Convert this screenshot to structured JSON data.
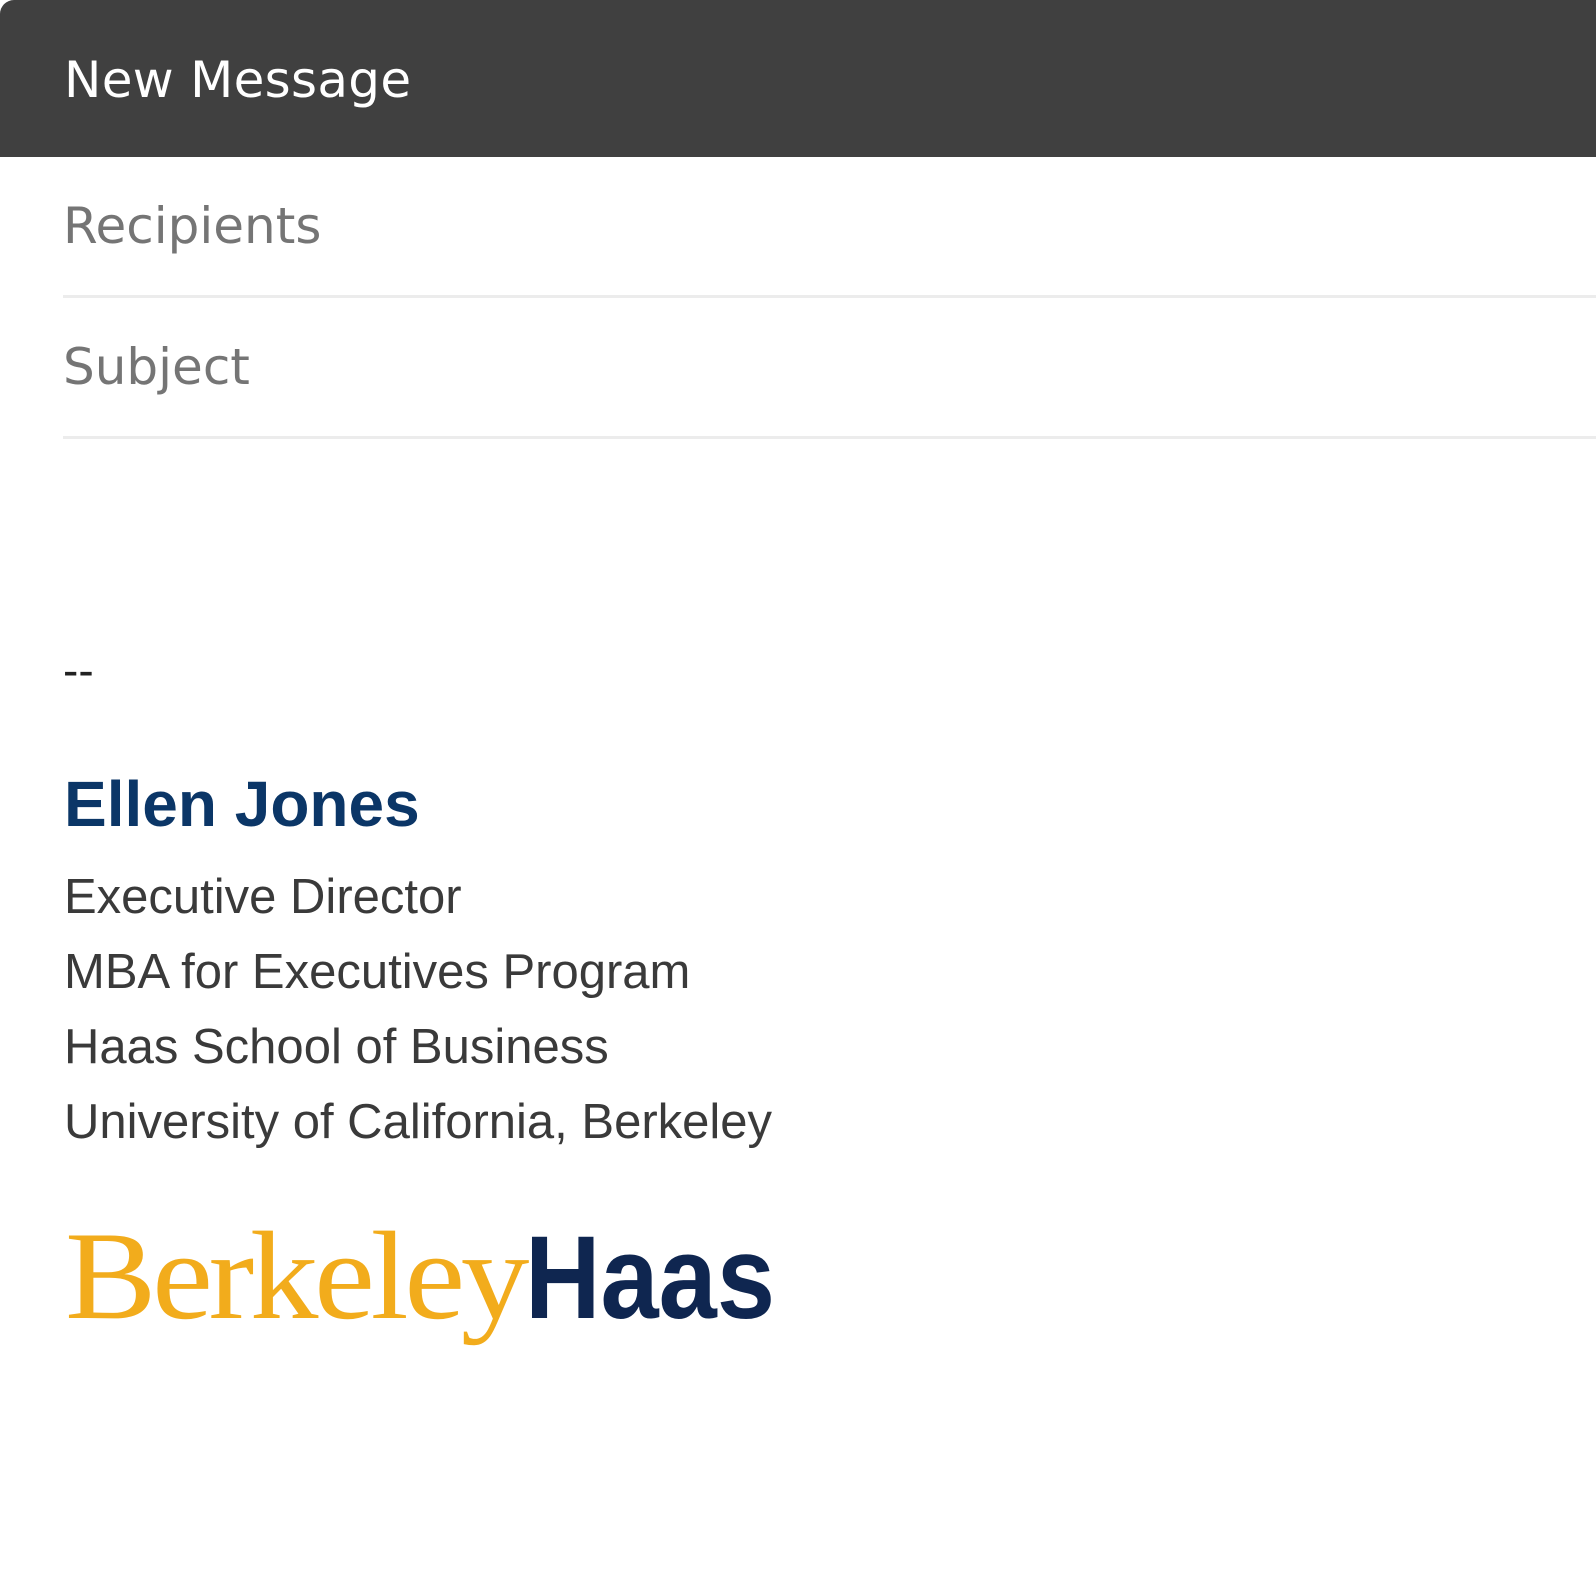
{
  "window": {
    "title": "New Message"
  },
  "compose": {
    "recipients": {
      "placeholder": "Recipients",
      "value": ""
    },
    "subject": {
      "placeholder": "Subject",
      "value": ""
    }
  },
  "signature": {
    "separator": "--",
    "name": "Ellen Jones",
    "lines": [
      "Executive Director",
      "MBA for Executives Program",
      "Haas School of Business",
      "University of California, Berkeley"
    ],
    "logo": {
      "part1": "Berkeley",
      "part2": "Haas",
      "color1": "#f2ac1c",
      "color2": "#0f2650"
    }
  },
  "colors": {
    "titlebar": "#404040",
    "name": "#0b3667",
    "text": "#3a3a3a"
  }
}
